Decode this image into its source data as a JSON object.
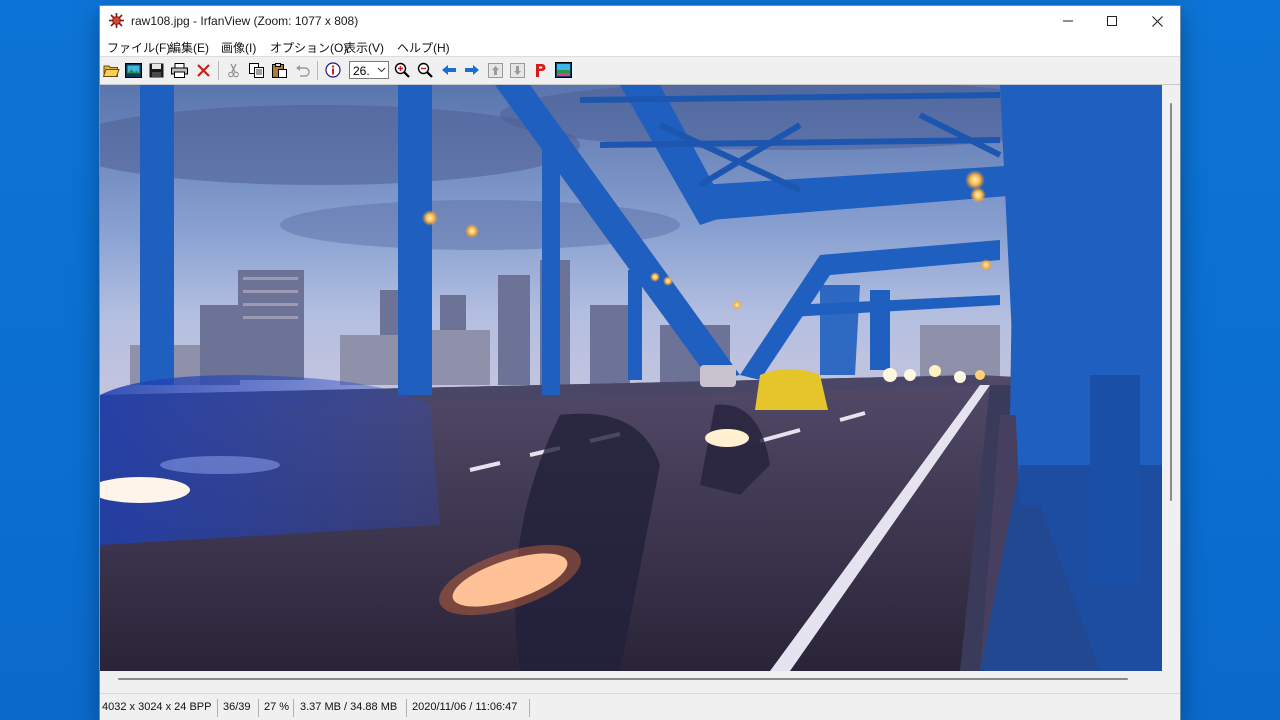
{
  "window": {
    "title": "raw108.jpg - IrfanView (Zoom: 1077 x 808)"
  },
  "menu": {
    "items": [
      {
        "label": "ファイル(F)"
      },
      {
        "label": "編集(E)"
      },
      {
        "label": "画像(I)"
      },
      {
        "label": "オプション(O)"
      },
      {
        "label": "表示(V)"
      },
      {
        "label": "ヘルプ(H)"
      }
    ]
  },
  "toolbar": {
    "zoom_value": "26.",
    "buttons": [
      {
        "icon": "open-folder-icon"
      },
      {
        "icon": "slideshow-icon"
      },
      {
        "icon": "save-icon"
      },
      {
        "icon": "print-icon"
      },
      {
        "icon": "delete-icon"
      },
      {
        "icon": "cut-icon"
      },
      {
        "icon": "copy-icon"
      },
      {
        "icon": "paste-icon"
      },
      {
        "icon": "undo-icon"
      },
      {
        "icon": "info-icon"
      },
      {
        "icon": "zoom-in-icon"
      },
      {
        "icon": "zoom-out-icon"
      },
      {
        "icon": "previous-arrow-icon"
      },
      {
        "icon": "next-arrow-icon"
      },
      {
        "icon": "first-file-icon"
      },
      {
        "icon": "last-file-icon"
      },
      {
        "icon": "paint-p-icon"
      },
      {
        "icon": "thumbnails-icon"
      }
    ]
  },
  "image": {
    "description_icon": "photo-canvas"
  },
  "status": {
    "dimensions": "4032 x 3024 x 24 BPP",
    "index": "36/39",
    "zoom": "27 %",
    "size": "3.37 MB / 34.88 MB",
    "datetime": "2020/11/06 / 11:06:47"
  },
  "colors": {
    "desktop": "#0a6fd1",
    "bridge_blue": "#1f5fbf",
    "sky": "#7f9ccf",
    "road": "#3a3550"
  }
}
